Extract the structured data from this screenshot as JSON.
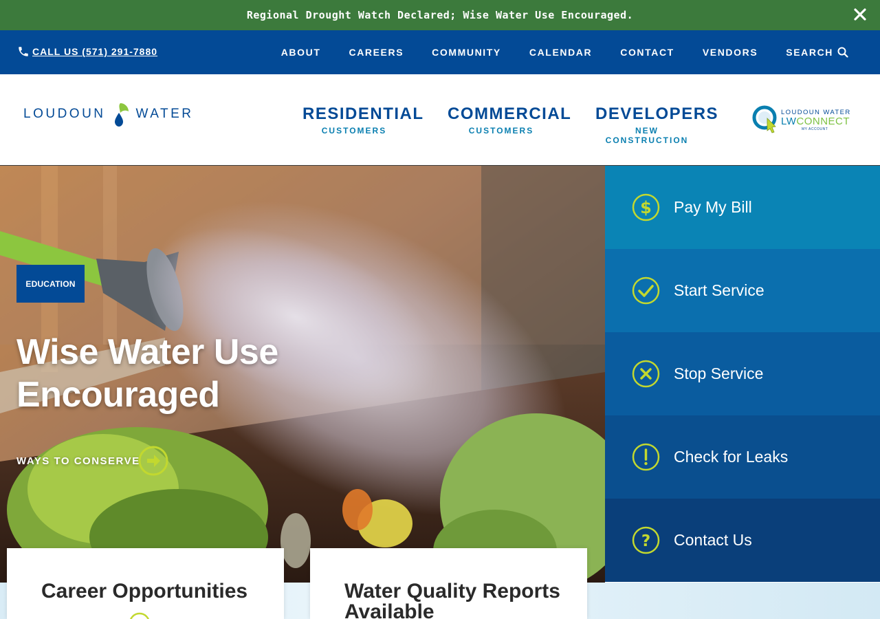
{
  "alert": {
    "text": "Regional Drought Watch Declared; Wise Water Use Encouraged."
  },
  "utility": {
    "call": "CALL US (571) 291-7880",
    "nav": [
      "ABOUT",
      "CAREERS",
      "COMMUNITY",
      "CALENDAR",
      "CONTACT",
      "VENDORS",
      "SEARCH"
    ]
  },
  "logo": {
    "left": "LOUDOUN",
    "right": "WATER"
  },
  "main_nav": [
    {
      "label": "RESIDENTIAL",
      "sub": "CUSTOMERS"
    },
    {
      "label": "COMMERCIAL",
      "sub": "CUSTOMERS"
    },
    {
      "label": "DEVELOPERS",
      "sub": "NEW CONSTRUCTION"
    }
  ],
  "lwconnect": {
    "top": "LOUDOUN WATER",
    "lw": "LW",
    "connect": "CONNECT",
    "sub": "MY ACCOUNT"
  },
  "hero": {
    "badge": "EDUCATION",
    "title": "Wise Water Use Encouraged",
    "cta": "WAYS TO CONSERVE"
  },
  "quick_links": [
    {
      "label": "Pay My Bill",
      "icon": "dollar-icon",
      "color": "#0a84b5"
    },
    {
      "label": "Start Service",
      "icon": "check-icon",
      "color": "#0b6fae"
    },
    {
      "label": "Stop Service",
      "icon": "x-icon",
      "color": "#0a5c9f"
    },
    {
      "label": "Check for Leaks",
      "icon": "exclamation-icon",
      "color": "#0a4f8f"
    },
    {
      "label": "Contact Us",
      "icon": "question-icon",
      "color": "#0a3f7a"
    }
  ],
  "cards": [
    {
      "title": "Career Opportunities"
    },
    {
      "title": "Water Quality Reports Available"
    }
  ],
  "colors": {
    "brand_blue": "#034a96",
    "alert_green": "#3c7a3c",
    "accent_green": "#c2d82f"
  }
}
